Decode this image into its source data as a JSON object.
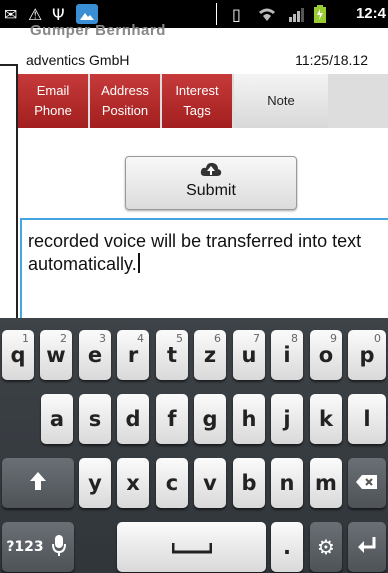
{
  "status_bar": {
    "icons": [
      "mail-icon",
      "warning-icon",
      "usb-icon",
      "gallery-icon",
      "vibrate-icon",
      "wifi-icon",
      "signal-icon",
      "battery-icon"
    ],
    "time": "12:4"
  },
  "header": {
    "ghost_title": "Gumper Bernhard",
    "company": "adventics GmbH",
    "timestamp": "11:25/18.12"
  },
  "tabs": [
    {
      "label": "Email\nPhone",
      "active": false
    },
    {
      "label": "Address\nPosition",
      "active": false
    },
    {
      "label": "Interest\nTags",
      "active": false
    },
    {
      "label": "Note",
      "active": true
    }
  ],
  "submit": {
    "label": "Submit",
    "icon": "cloud-upload-icon"
  },
  "note": {
    "value": "recorded voice will be transferred into text automatically."
  },
  "keyboard": {
    "row1": [
      "q",
      "w",
      "e",
      "r",
      "t",
      "z",
      "u",
      "i",
      "o",
      "p"
    ],
    "row1_hints": [
      "1",
      "2",
      "3",
      "4",
      "5",
      "6",
      "7",
      "8",
      "9",
      "0"
    ],
    "row2": [
      "a",
      "s",
      "d",
      "f",
      "g",
      "h",
      "j",
      "k",
      "l"
    ],
    "row3": [
      "y",
      "x",
      "c",
      "v",
      "b",
      "n",
      "m"
    ],
    "row4": {
      "sym": "?123",
      "dot": "."
    }
  },
  "colors": {
    "tab_red": "#b52b2b",
    "focus_blue": "#44a5e2",
    "keyboard_bg": "#373c41"
  }
}
